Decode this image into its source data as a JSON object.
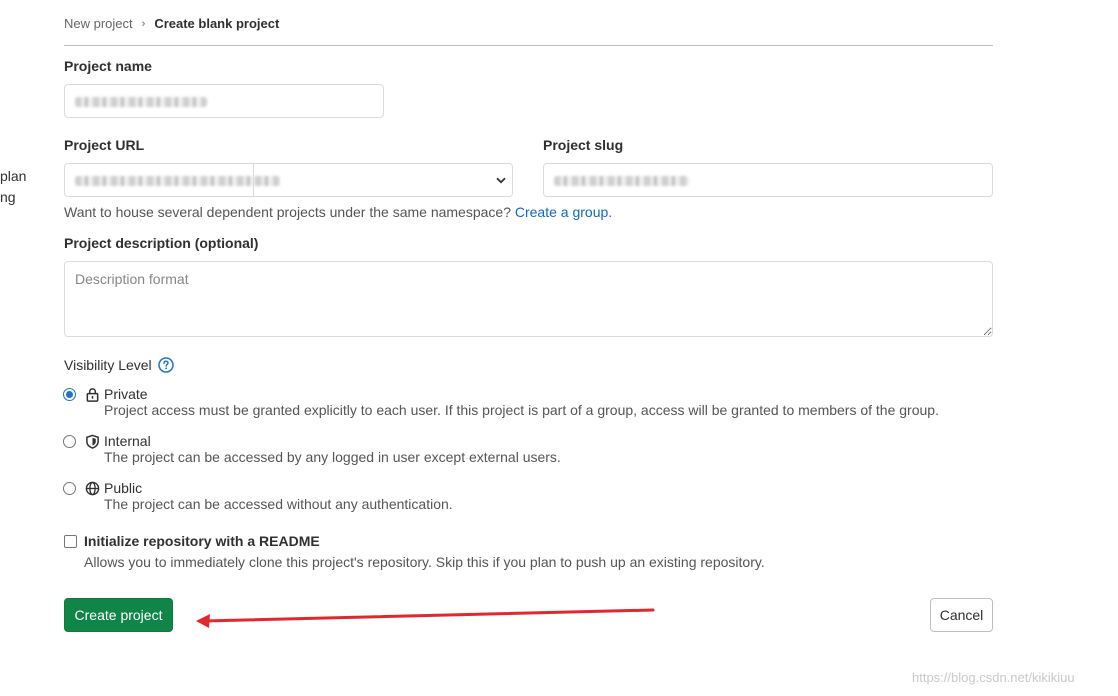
{
  "side_fragments": [
    "plan",
    "ng"
  ],
  "breadcrumb": {
    "parent": "New project",
    "current": "Create blank project"
  },
  "form": {
    "project_name": {
      "label": "Project name",
      "value": ""
    },
    "project_url": {
      "label": "Project URL",
      "value": ""
    },
    "project_slug": {
      "label": "Project slug",
      "value": ""
    },
    "namespace_hint": {
      "text": "Want to house several dependent projects under the same namespace?",
      "link": "Create a group."
    },
    "description": {
      "label": "Project description (optional)",
      "placeholder": "Description format"
    },
    "visibility": {
      "title": "Visibility Level",
      "options": [
        {
          "label": "Private",
          "description": "Project access must be granted explicitly to each user. If this project is part of a group, access will be granted to members of the group.",
          "icon": "lock-icon",
          "checked": true
        },
        {
          "label": "Internal",
          "description": "The project can be accessed by any logged in user except external users.",
          "icon": "shield-icon",
          "checked": false
        },
        {
          "label": "Public",
          "description": "The project can be accessed without any authentication.",
          "icon": "globe-icon",
          "checked": false
        }
      ]
    },
    "readme": {
      "label": "Initialize repository with a README",
      "description": "Allows you to immediately clone this project's repository. Skip this if you plan to push up an existing repository.",
      "checked": false
    },
    "create_button": "Create project",
    "cancel_button": "Cancel"
  },
  "watermark": "https://blog.csdn.net/kikikiuu",
  "colors": {
    "primary_green": "#108548",
    "link_blue": "#1068bf",
    "radio_blue": "#1f75cb",
    "annotation_red": "#e0282e"
  }
}
